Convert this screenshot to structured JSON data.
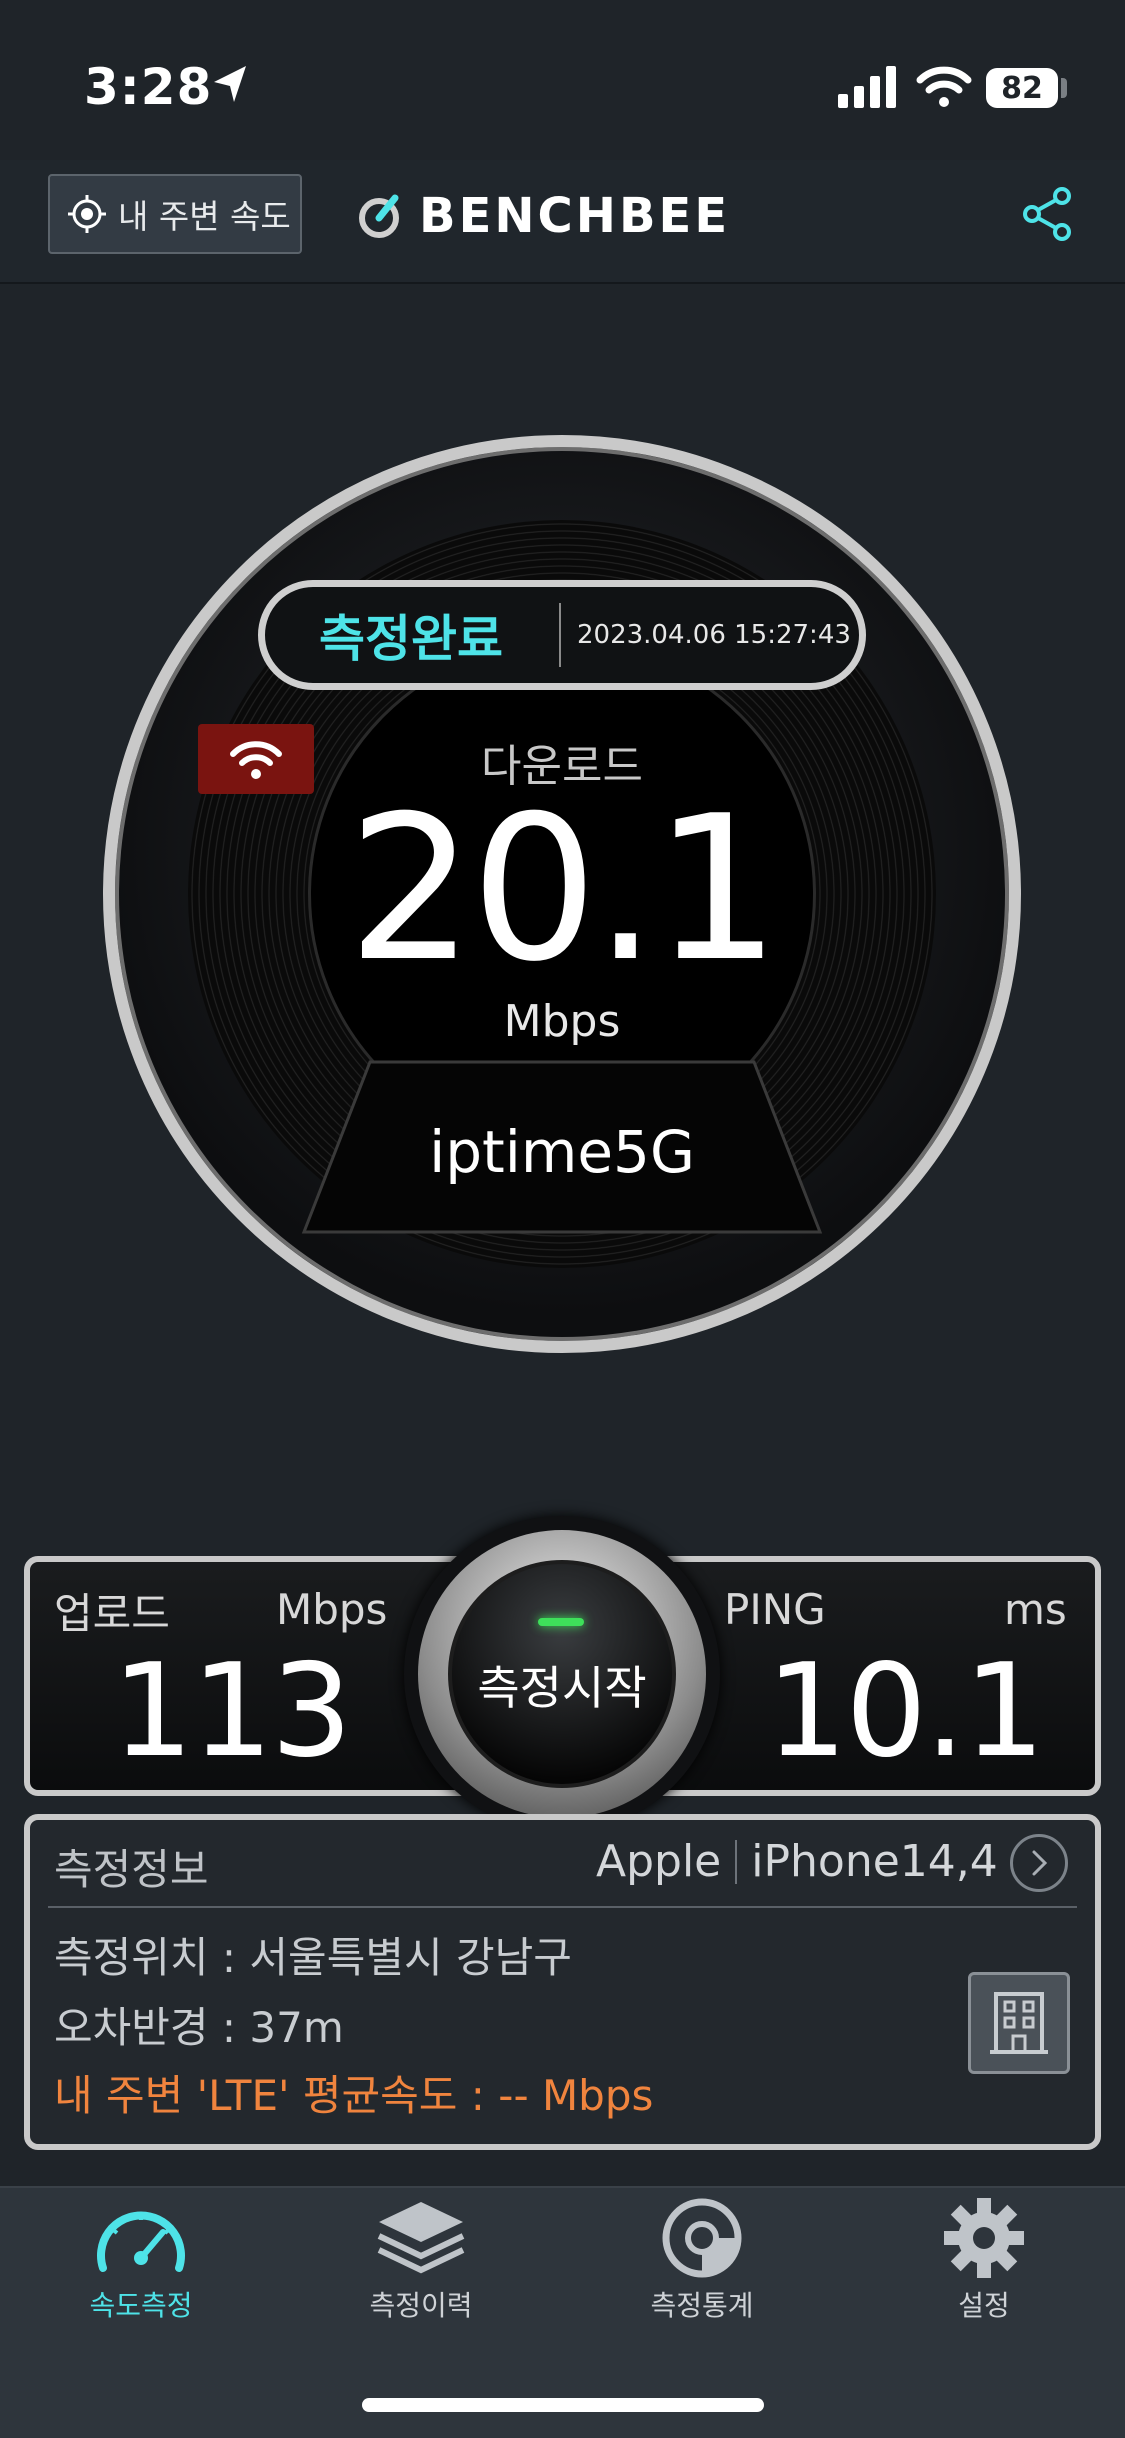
{
  "status_bar": {
    "time": "3:28",
    "battery": "82"
  },
  "header": {
    "near_button_label": "내 주변 속도",
    "brand": "BENCHBEE"
  },
  "gauge": {
    "status": "측정완료",
    "timestamp": "2023.04.06 15:27:43",
    "download_label": "다운로드",
    "download_value": "20.1",
    "download_unit": "Mbps",
    "network_name": "iptime5G"
  },
  "results": {
    "upload_label": "업로드",
    "upload_unit": "Mbps",
    "upload_value": "113",
    "ping_label": "PING",
    "ping_unit": "ms",
    "ping_value": "10.1",
    "start_label": "측정시작"
  },
  "info": {
    "title": "측정정보",
    "manufacturer": "Apple",
    "model": "iPhone14,4",
    "location": "측정위치 : 서울특별시 강남구",
    "error_radius": "오차반경 : 37m",
    "lte_average": "내 주변 'LTE' 평균속도 : -- Mbps"
  },
  "tabs": [
    {
      "label": "속도측정",
      "icon": "speedometer-icon",
      "active": true
    },
    {
      "label": "측정이력",
      "icon": "layers-icon",
      "active": false
    },
    {
      "label": "측정통계",
      "icon": "stats-dial-icon",
      "active": false
    },
    {
      "label": "설정",
      "icon": "gear-icon",
      "active": false
    }
  ],
  "colors": {
    "accent": "#4ee3e8",
    "warning": "#f0843e",
    "wifi_badge": "#7a1410",
    "background": "#1f2429"
  }
}
